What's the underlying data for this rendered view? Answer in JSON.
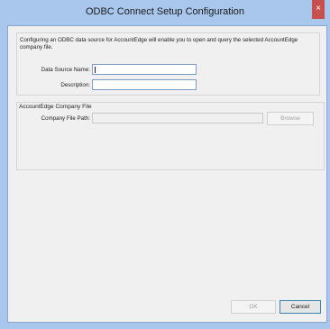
{
  "window": {
    "title": "ODBC Connect Setup Configuration",
    "close_glyph": "×"
  },
  "intro_text": "Configuring an ODBC data source for AccountEdge will enable you to open and query the selected AccountEdge company file.",
  "data_source": {
    "name_label": "Data Source Name:",
    "name_value": "",
    "description_label": "Description:",
    "description_value": ""
  },
  "company_file": {
    "section_title": "AccountEdge Company File",
    "path_label": "Company File Path:",
    "path_value": "",
    "browse_label": "Browse"
  },
  "footer": {
    "ok_label": "OK",
    "cancel_label": "Cancel"
  },
  "colors": {
    "titlebar": "#a9c7ed",
    "close": "#c7504f",
    "dialog_bg": "#f0f0f0"
  },
  "icons": {
    "close": "close-icon"
  }
}
